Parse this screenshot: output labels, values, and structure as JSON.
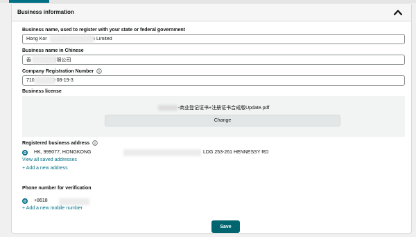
{
  "section": {
    "title": "Business information"
  },
  "fields": {
    "business_name": {
      "label": "Business name, used to register with your state or federal government",
      "value": "Hong Kor            Technology Co Limited"
    },
    "chinese_name": {
      "label": "Business name in Chinese",
      "value": "香        司技有限公司"
    },
    "registration_number": {
      "label": "Company Registration Number",
      "value": "710        -000-08-19-3"
    }
  },
  "license": {
    "label": "Business license",
    "filename": "-商业登记证书+注册证书合成版Update.pdf",
    "change_label": "Change"
  },
  "address": {
    "label": "Registered business address",
    "value_start": "HK, 999077, HONGKONG",
    "value_end": "LDG 253-261 HENNESSY RD",
    "view_all": "View all saved addresses",
    "add_new": "+ Add a new address"
  },
  "phone": {
    "label": "Phone number for verification",
    "value": "+8618",
    "add_new": "+ Add a new mobile number"
  },
  "actions": {
    "save_label": "Save"
  }
}
